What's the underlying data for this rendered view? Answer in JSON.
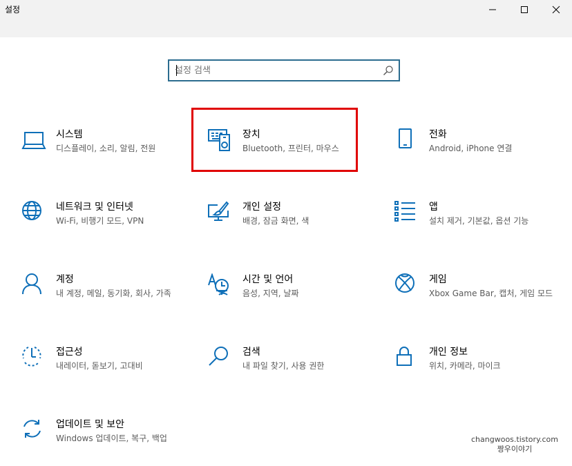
{
  "window": {
    "title": "설정",
    "controls": {
      "minimize": "minimize",
      "maximize": "maximize",
      "close": "close"
    }
  },
  "search": {
    "placeholder": "설정 검색",
    "value": ""
  },
  "accent_color": "#0e6fb8",
  "highlight_color": "#e00000",
  "tiles": [
    {
      "title": "시스템",
      "desc": "디스플레이, 소리, 알림, 전원",
      "icon": "laptop-icon"
    },
    {
      "title": "장치",
      "desc": "Bluetooth, 프린터, 마우스",
      "icon": "devices-icon"
    },
    {
      "title": "전화",
      "desc": "Android, iPhone 연결",
      "icon": "phone-icon"
    },
    {
      "title": "네트워크 및 인터넷",
      "desc": "Wi-Fi, 비행기 모드, VPN",
      "icon": "globe-icon"
    },
    {
      "title": "개인 설정",
      "desc": "배경, 잠금 화면, 색",
      "icon": "paintbrush-monitor-icon"
    },
    {
      "title": "앱",
      "desc": "설치 제거, 기본값, 옵션 기능",
      "icon": "app-list-icon"
    },
    {
      "title": "계정",
      "desc": "내 계정, 메일, 동기화, 회사, 가족",
      "icon": "person-icon"
    },
    {
      "title": "시간 및 언어",
      "desc": "음성, 지역, 날짜",
      "icon": "time-language-icon"
    },
    {
      "title": "게임",
      "desc": "Xbox Game Bar, 캡처, 게임 모드",
      "icon": "xbox-icon"
    },
    {
      "title": "접근성",
      "desc": "내레이터, 돋보기, 고대비",
      "icon": "ease-of-access-icon"
    },
    {
      "title": "검색",
      "desc": "내 파일 찾기, 사용 권한",
      "icon": "search-icon"
    },
    {
      "title": "개인 정보",
      "desc": "위치, 카메라, 마이크",
      "icon": "lock-icon"
    },
    {
      "title": "업데이트 및 보안",
      "desc": "Windows 업데이트, 복구, 백업",
      "icon": "sync-icon"
    }
  ],
  "watermark": {
    "line1": "changwoos.tistory.com",
    "line2": "짱우이야기"
  }
}
